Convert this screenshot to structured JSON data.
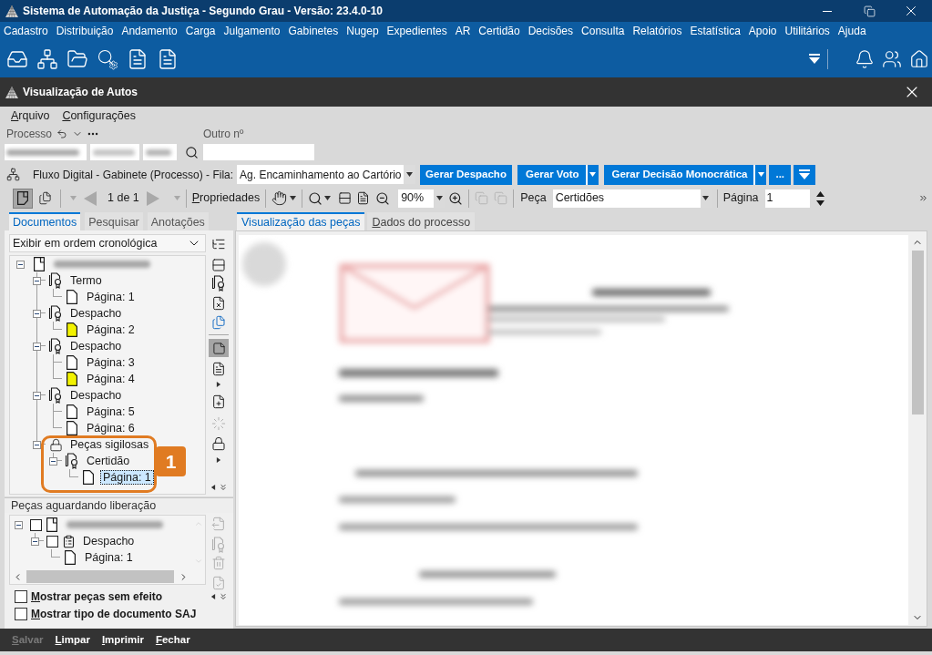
{
  "window": {
    "title": "Sistema de Automação da Justiça - Segundo Grau - Versão: 23.4.0-10"
  },
  "menu_bar": [
    "Cadastro",
    "Distribuição",
    "Andamento",
    "Carga",
    "Julgamento",
    "Gabinetes",
    "Nugep",
    "Expedientes",
    "AR",
    "Certidão",
    "Decisões",
    "Consulta",
    "Relatórios",
    "Estatística",
    "Apoio",
    "Utilitários",
    "Ajuda"
  ],
  "dialog": {
    "title": "Visualização de Autos",
    "menu": [
      "Arquivo",
      "Configurações"
    ]
  },
  "process": {
    "label": "Processo",
    "other_label": "Outro nº"
  },
  "flow": {
    "label": "Fluxo Digital - Gabinete (Processo) - Fila:",
    "queue": "Ag. Encaminhamento ao Cartório",
    "actions": [
      {
        "label": "Gerar Despacho",
        "kind": "button"
      },
      {
        "label": "Gerar Voto",
        "kind": "split"
      },
      {
        "label": "Gerar Decisão Monocrática",
        "kind": "split"
      },
      {
        "label": "...",
        "kind": "button"
      }
    ]
  },
  "viewer_toolbar": {
    "view_modes": [
      {
        "kind": "single",
        "selected": true
      },
      {
        "kind": "pages",
        "selected": false
      }
    ],
    "page_counter": "1 de 1",
    "properties": "Propriedades",
    "zoom": "90%",
    "piece_label": "Peça",
    "piece": "Certidões",
    "page_label": "Página",
    "page": "1"
  },
  "left_tabs": [
    {
      "label": "Documentos",
      "selected": true
    },
    {
      "label": "Pesquisar",
      "selected": false
    },
    {
      "label": "Anotações",
      "selected": false
    }
  ],
  "documents": {
    "order": "Exibir em ordem cronológica",
    "notes_toggle": {
      "selected": true
    },
    "tree": [
      {
        "kind": "process",
        "expanded": true,
        "selected": false,
        "children": [
          {
            "label": "Termo",
            "kind": "signed",
            "expanded": true,
            "selected": false,
            "children": [
              {
                "label": "Página: 1",
                "kind": "page",
                "color": "#ffffff",
                "selected": false
              }
            ]
          },
          {
            "label": "Despacho",
            "kind": "signed",
            "expanded": true,
            "selected": false,
            "children": [
              {
                "label": "Página: 2",
                "kind": "page",
                "color": "#f2f200",
                "selected": false
              }
            ]
          },
          {
            "label": "Despacho",
            "kind": "signed",
            "expanded": true,
            "selected": false,
            "children": [
              {
                "label": "Página: 3",
                "kind": "page",
                "color": "#ffffff",
                "selected": false
              },
              {
                "label": "Página: 4",
                "kind": "page",
                "color": "#f2f200",
                "selected": false
              }
            ]
          },
          {
            "label": "Despacho",
            "kind": "signed",
            "expanded": true,
            "selected": false,
            "children": [
              {
                "label": "Página: 5",
                "kind": "page",
                "color": "#ffffff",
                "selected": false
              },
              {
                "label": "Página: 6",
                "kind": "page",
                "color": "#ffffff",
                "selected": false
              }
            ]
          },
          {
            "label": "Peças sigilosas",
            "kind": "lock",
            "expanded": true,
            "selected": false,
            "children": [
              {
                "label": "Certidão",
                "kind": "signed",
                "expanded": true,
                "selected": false,
                "children": [
                  {
                    "label": "Página: 1",
                    "kind": "page",
                    "color": "#ffffff",
                    "selected": true
                  }
                ]
              }
            ]
          }
        ]
      }
    ]
  },
  "callout": {
    "label": "1"
  },
  "pending": {
    "title": "Peças aguardando liberação",
    "tree": [
      {
        "kind": "process",
        "expanded": true,
        "checked": false,
        "children": [
          {
            "label": "Despacho",
            "kind": "document",
            "expanded": true,
            "checked": false,
            "children": [
              {
                "label": "Página: 1",
                "kind": "page",
                "color": "#ffffff"
              }
            ]
          }
        ]
      }
    ]
  },
  "options": [
    {
      "label": "Mostrar peças sem efeito",
      "checked": false
    },
    {
      "label": "Mostrar tipo de documento SAJ",
      "checked": false
    }
  ],
  "viewer_tabs": [
    {
      "label": "Visualização das peças",
      "selected": true
    },
    {
      "label": "Dados do processo",
      "selected": false
    }
  ],
  "footer": [
    {
      "label": "Salvar",
      "disabled": true
    },
    {
      "label": "Limpar",
      "disabled": false
    },
    {
      "label": "Imprimir",
      "disabled": false
    },
    {
      "label": "Fechar",
      "disabled": false
    }
  ]
}
